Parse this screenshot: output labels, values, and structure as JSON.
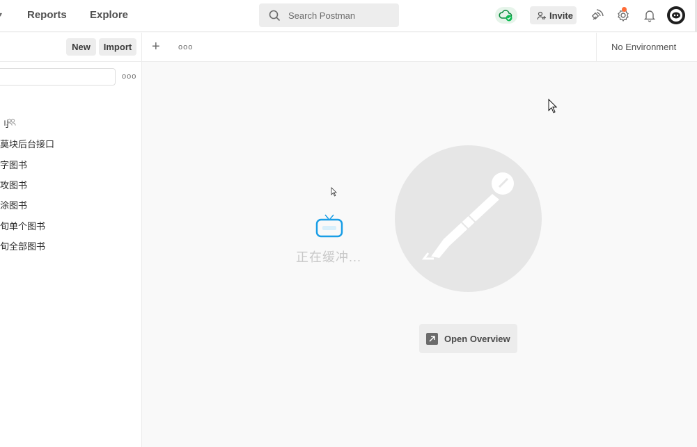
{
  "header": {
    "nav": [
      "Reports",
      "Explore"
    ],
    "search_placeholder": "Search Postman",
    "invite_label": "Invite"
  },
  "sidebar": {
    "new_label": "New",
    "import_label": "Import",
    "items": [
      {
        "label": "刂"
      },
      {
        "label": "莫块后台接口"
      },
      {
        "label": "字图书"
      },
      {
        "label": "攻图书"
      },
      {
        "label": "涂图书"
      },
      {
        "label": "旬单个图书"
      },
      {
        "label": "旬全部图书"
      }
    ]
  },
  "tabbar": {
    "environment": "No Environment"
  },
  "main": {
    "buffering_text": "正在缓冲...",
    "open_overview_label": "Open Overview"
  },
  "colors": {
    "sync_green": "#0cbb52",
    "notification_orange": "#ff6c37",
    "tv_blue": "#1a9ee6"
  }
}
